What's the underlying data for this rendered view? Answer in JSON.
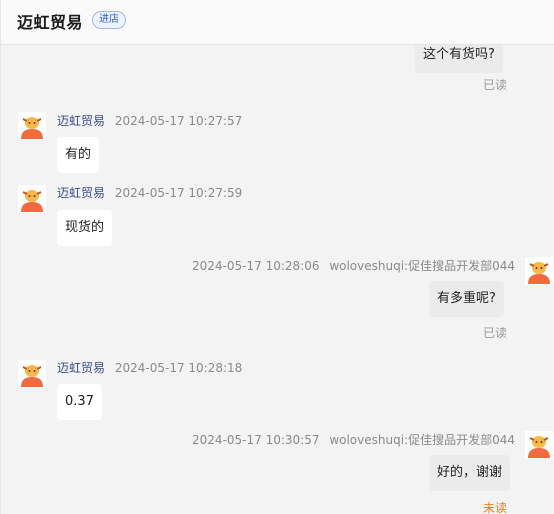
{
  "header": {
    "title": "迈虹贸易",
    "badge": "进店"
  },
  "messages": {
    "m0": {
      "text": "这个有货吗?",
      "status": "已读"
    },
    "m1": {
      "sender": "迈虹贸易",
      "time": "2024-05-17 10:27:57",
      "text": "有的"
    },
    "m2": {
      "sender": "迈虹贸易",
      "time": "2024-05-17 10:27:59",
      "text": "现货的"
    },
    "m3": {
      "time": "2024-05-17 10:28:06",
      "sender": "woloveshuqi:促佳搜品开发部044",
      "text": "有多重呢?",
      "status": "已读"
    },
    "m4": {
      "sender": "迈虹贸易",
      "time": "2024-05-17 10:28:18",
      "text": "0.37"
    },
    "m5": {
      "time": "2024-05-17 10:30:57",
      "sender": "woloveshuqi:促佳搜品开发部044",
      "text": "好的，谢谢",
      "status": "未读"
    }
  },
  "colors": {
    "avatar_body": "#f26a3d",
    "avatar_face": "#f6b94a",
    "unread": "#e0831f"
  }
}
